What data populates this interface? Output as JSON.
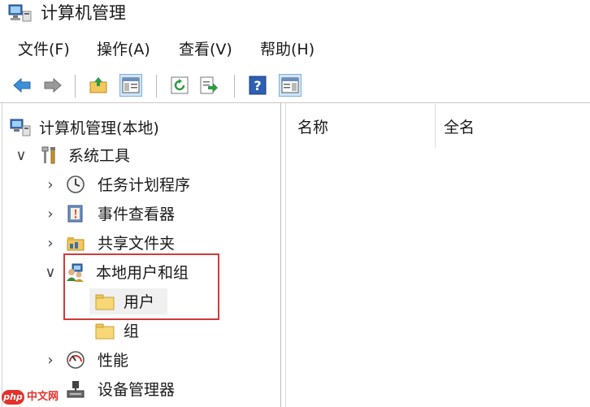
{
  "window": {
    "title": "计算机管理"
  },
  "menu": {
    "items": [
      "文件(F)",
      "操作(A)",
      "查看(V)",
      "帮助(H)"
    ]
  },
  "toolbar": {
    "buttons": [
      {
        "icon": "back-arrow-icon"
      },
      {
        "icon": "forward-arrow-icon"
      },
      {
        "icon": "up-folder-icon"
      },
      {
        "icon": "show-hide-console-tree-icon"
      },
      {
        "icon": "refresh-icon"
      },
      {
        "icon": "export-list-icon"
      },
      {
        "icon": "help-icon"
      },
      {
        "icon": "show-hide-action-pane-icon"
      }
    ]
  },
  "tree": {
    "root": "计算机管理(本地)",
    "system_tools": "系统工具",
    "task_scheduler": "任务计划程序",
    "event_viewer": "事件查看器",
    "shared_folders": "共享文件夹",
    "local_users_groups": "本地用户和组",
    "users": "用户",
    "groups": "组",
    "performance": "性能",
    "device_manager": "设备管理器",
    "expanded_glyph": "∨",
    "collapsed_glyph": "›"
  },
  "list": {
    "columns": [
      "名称",
      "全名"
    ]
  },
  "watermark": {
    "badge": "php",
    "text": "中文网"
  },
  "colors": {
    "highlight_border": "#d23a3a",
    "watermark": "#e3322b"
  }
}
